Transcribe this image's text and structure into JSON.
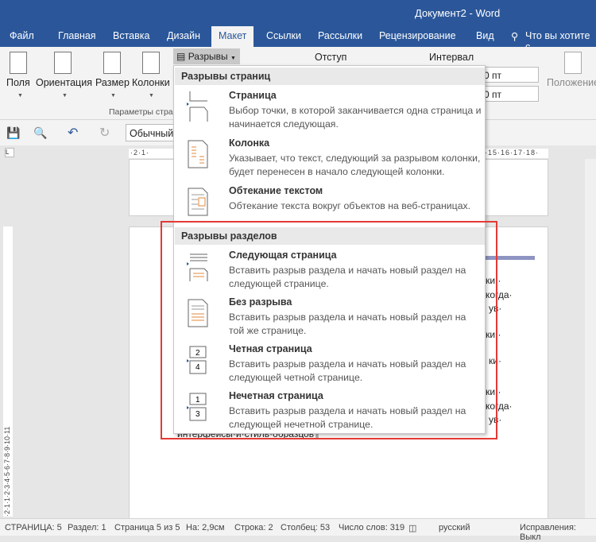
{
  "window": {
    "title": "Документ2 - Word"
  },
  "tabs": [
    "Файл",
    "Главная",
    "Вставка",
    "Дизайн",
    "Макет",
    "Ссылки",
    "Рассылки",
    "Рецензирование",
    "Вид"
  ],
  "active_tab": "Макет",
  "tell_me": "Что вы хотите с",
  "ribbon": {
    "buttons": [
      "Поля",
      "Ориентация",
      "Размер",
      "Колонки"
    ],
    "breaks": "Разрывы",
    "indent": "Отступ",
    "spacing": "Интервал",
    "spacing_before": "0 пт",
    "spacing_after": "0 пт",
    "position": "Положение",
    "group_label": "Параметры стра"
  },
  "qat": {
    "style": "Обычный"
  },
  "ruler": {
    "h_left": "·2·1·",
    "h_right": "·15·16·17·18·",
    "v": "·2·1·1·2·3·4·5·6·7·8·9·10·11"
  },
  "document": {
    "fragments": [
      "остки.·",
      "гг.,·когда·",
      "ув·",
      "остки.·",
      "ки·",
      "остки.·",
      "гг.,·когда·",
      "ув·",
      "интерфейсы·и·стиль·образцов¶"
    ]
  },
  "dropdown": {
    "page_breaks_header": "Разрывы страниц",
    "page_breaks": [
      {
        "title": "Страница",
        "desc": "Выбор точки, в которой заканчивается одна страница и начинается следующая."
      },
      {
        "title": "Колонка",
        "desc": "Указывает, что текст, следующий за разрывом колонки, будет перенесен в начало следующей колонки."
      },
      {
        "title": "Обтекание текстом",
        "desc": "Обтекание текста вокруг объектов на веб-страницах."
      }
    ],
    "section_breaks_header": "Разрывы разделов",
    "section_breaks": [
      {
        "title": "Следующая страница",
        "desc": "Вставить разрыв раздела и начать новый раздел на следующей странице."
      },
      {
        "title": "Без разрыва",
        "desc": "Вставить разрыв раздела и начать новый раздел на той же странице."
      },
      {
        "title": "Четная страница",
        "desc": "Вставить разрыв раздела и начать новый раздел на следующей четной странице."
      },
      {
        "title": "Нечетная страница",
        "desc": "Вставить разрыв раздела и начать новый раздел на следующей нечетной странице."
      }
    ]
  },
  "status": {
    "page": "СТРАНИЦА: 5",
    "section": "Раздел: 1",
    "pages": "Страница 5 из 5",
    "at": "На: 2,9см",
    "line": "Строка: 2",
    "column": "Столбец: 53",
    "words": "Число слов: 319",
    "language": "русский",
    "track": "Исправления: Выкл"
  },
  "colors": {
    "brand": "#2b579a",
    "highlight": "#e53935"
  }
}
